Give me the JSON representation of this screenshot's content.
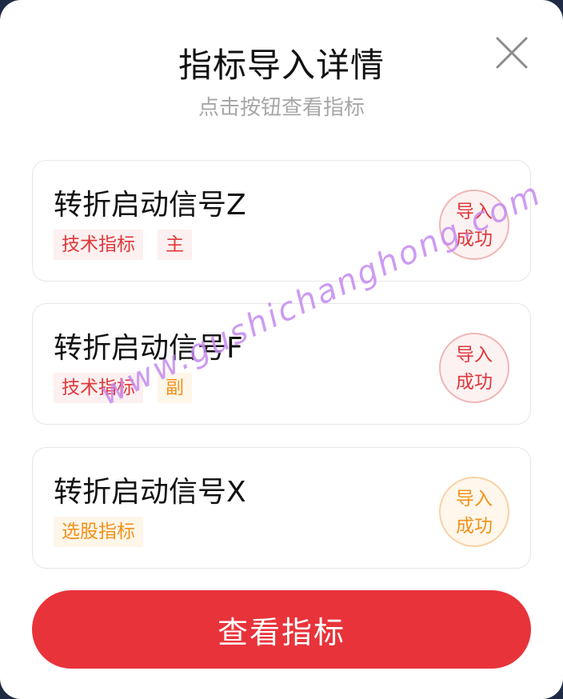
{
  "modal": {
    "title": "指标导入详情",
    "subtitle": "点击按钮查看指标",
    "close_icon": "close-icon"
  },
  "indicators": [
    {
      "name": "转折启动信号Z",
      "tags": [
        {
          "label": "技术指标",
          "color": "#e0373a"
        },
        {
          "label": "主",
          "color": "#e0373a"
        }
      ],
      "status": {
        "line1": "导入",
        "line2": "成功",
        "color": "#e0373a"
      }
    },
    {
      "name": "转折启动信号F",
      "tags": [
        {
          "label": "技术指标",
          "color": "#e0373a"
        },
        {
          "label": "副",
          "color": "#f09219"
        }
      ],
      "status": {
        "line1": "导入",
        "line2": "成功",
        "color": "#e0373a"
      }
    },
    {
      "name": "转折启动信号X",
      "tags": [
        {
          "label": "选股指标",
          "color": "#f09219"
        }
      ],
      "status": {
        "line1": "导入",
        "line2": "成功",
        "color": "#f09219"
      }
    }
  ],
  "watermark": "www.gushichanghong.com",
  "action": {
    "label": "查看指标",
    "color": "#e8333a"
  }
}
